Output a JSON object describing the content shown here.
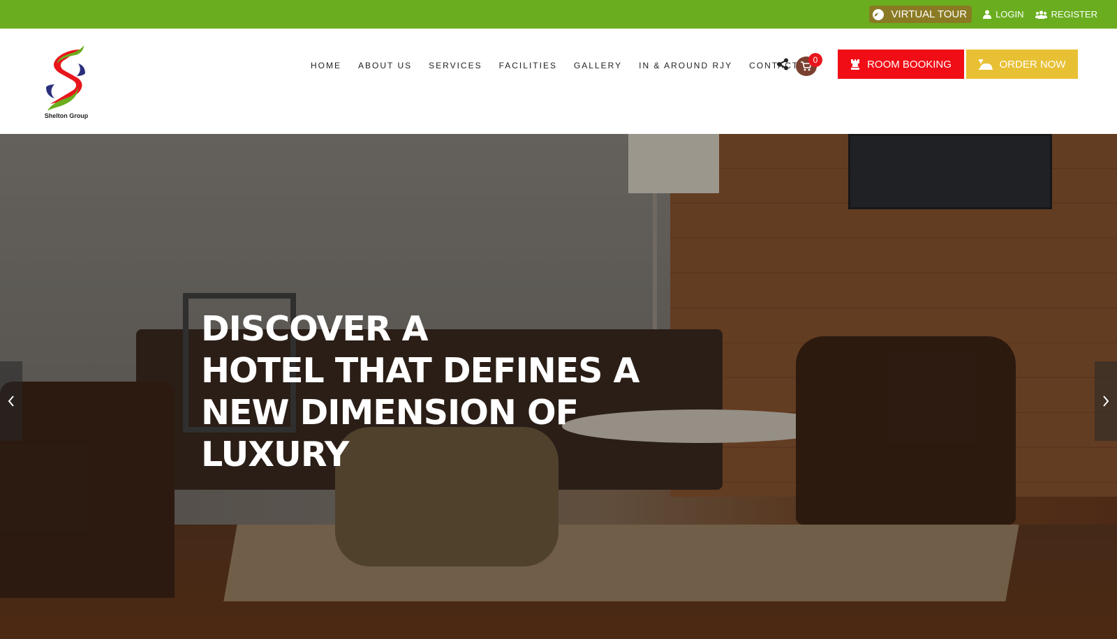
{
  "topbar": {
    "virtual_tour": "VIRTUAL TOUR",
    "login": "LOGIN",
    "register": "REGISTER",
    "color": "#6aae1f"
  },
  "brand": {
    "caption": "Shelton Group"
  },
  "nav": {
    "items": [
      "HOME",
      "ABOUT US",
      "SERVICES",
      "FACILITIES",
      "GALLERY",
      "IN & AROUND RJY",
      "CONTACT"
    ]
  },
  "cart": {
    "count": "0"
  },
  "buttons": {
    "room_booking": "ROOM BOOKING",
    "order_now": "ORDER NOW",
    "room_color": "#f00d16",
    "order_color": "#e8c034"
  },
  "hero": {
    "lines": [
      "DISCOVER A",
      "HOTEL THAT DEFINES A",
      "NEW DIMENSION OF",
      "LUXURY"
    ]
  },
  "icons": {
    "virtual_tour": "compass-icon",
    "login": "user-icon",
    "register": "users-icon",
    "share": "share-icon",
    "cart": "cart-icon",
    "room_booking": "chess-rook-icon",
    "order_now": "food-tray-icon",
    "prev": "chevron-left-icon",
    "next": "chevron-right-icon"
  }
}
